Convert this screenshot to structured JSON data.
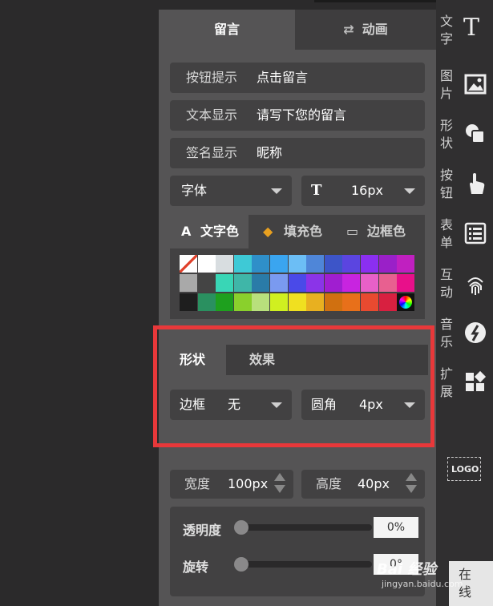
{
  "tabs": {
    "message": "留言",
    "animation": "动画"
  },
  "fields": [
    {
      "label": "按钮提示",
      "value": "点击留言"
    },
    {
      "label": "文本显示",
      "value": "请写下您的留言"
    },
    {
      "label": "签名显示",
      "value": "昵称"
    }
  ],
  "font": {
    "label": "字体",
    "size": "16px"
  },
  "color_tabs": {
    "text": "文字色",
    "fill": "填充色",
    "border": "边框色"
  },
  "swatches": [
    [
      "none",
      "#ffffff",
      "#d8dde0",
      "#3ec9d6",
      "#2f8fc9",
      "#3aa5f0",
      "#6cbef5",
      "#4f86d8",
      "#3d55c8",
      "#5b45e0",
      "#8b2ff0",
      "#9a20c8",
      "#c020c0"
    ],
    [
      "#a9a9a9",
      "#444444",
      "#39d6b6",
      "#3fb6a8",
      "#2a7ba8",
      "#7a9af0",
      "#4a4ae8",
      "#8b34e8",
      "#a01ed0",
      "#c824e0",
      "#e860c8",
      "#e86090",
      "#e8108a"
    ],
    [
      "#1e1e1e",
      "#2a9060",
      "#1ea01e",
      "#8ad02c",
      "#b8e07c",
      "#d0f020",
      "#f0e020",
      "#e8b020",
      "#d07010",
      "#e8701a",
      "#e84a30",
      "#d82040",
      "wheel"
    ]
  ],
  "shape_tabs": {
    "shape": "形状",
    "effect": "效果"
  },
  "border": {
    "label": "边框",
    "value": "无"
  },
  "radius": {
    "label": "圆角",
    "value": "4px"
  },
  "width": {
    "label": "宽度",
    "value": "100px"
  },
  "height": {
    "label": "高度",
    "value": "40px"
  },
  "opacity": {
    "label": "透明度",
    "value": "0%",
    "level": 0
  },
  "rotation": {
    "label": "旋转",
    "value": "0°",
    "level": 0
  },
  "sidebar": [
    {
      "text": "文字",
      "icon": "text-icon"
    },
    {
      "text": "图片",
      "icon": "image-icon"
    },
    {
      "text": "形状",
      "icon": "shape-icon"
    },
    {
      "text": "按钮",
      "icon": "button-icon"
    },
    {
      "text": "表单",
      "icon": "form-icon"
    },
    {
      "text": "互动",
      "icon": "fingerprint-icon"
    },
    {
      "text": "音乐",
      "icon": "music-icon"
    },
    {
      "text": "扩展",
      "icon": "extension-icon"
    }
  ],
  "logo_label": "LOGO",
  "watermark": {
    "brand": "Bai 经验",
    "url": "jingyan.baidu.com"
  },
  "corner_text": "在线",
  "colors": {
    "highlight": "#e8383a",
    "panel": "#555455"
  }
}
